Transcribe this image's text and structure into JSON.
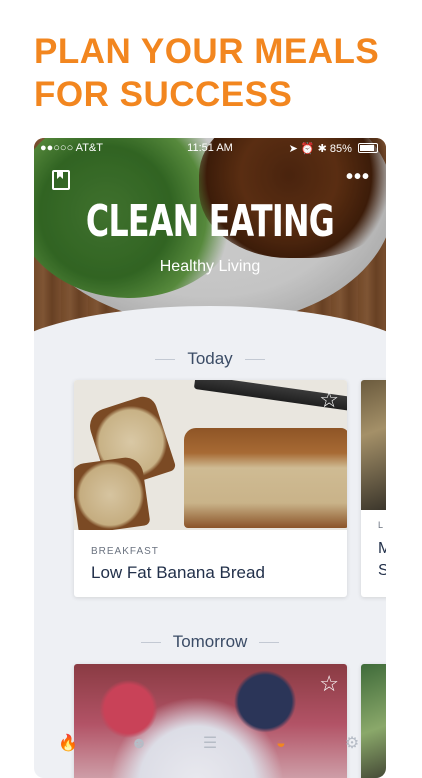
{
  "headline": {
    "line1": "PLAN YOUR MEALS",
    "line2": "FOR SUCCESS"
  },
  "status_bar": {
    "carrier": "●●○○○ AT&T",
    "time": "11:51 AM",
    "battery": "85%",
    "battery_level": 0.85,
    "icons": [
      "wifi-icon",
      "location-arrow-icon",
      "alarm-icon",
      "bluetooth-icon",
      "battery-icon"
    ]
  },
  "hero": {
    "title": "CLEAN EATING",
    "subtitle": "Healthy Living",
    "bookmark_icon": "bookmark-icon",
    "more_icon": "more-dots-icon",
    "more_glyph": "•••"
  },
  "sections": [
    {
      "label": "Today"
    },
    {
      "label": "Tomorrow"
    }
  ],
  "cards": [
    {
      "category": "BREAKFAST",
      "title": "Low Fat Banana Bread",
      "favorite": false
    },
    {
      "category": "",
      "title": "",
      "favorite": false
    }
  ],
  "peek_card": {
    "category": "L",
    "title_line1": "M",
    "title_line2": "S"
  },
  "star_glyph": "☆",
  "tab_bar": {
    "tabs": [
      {
        "icon": "flame-icon",
        "glyph": "🔥",
        "active": false
      },
      {
        "icon": "smiley-icon",
        "glyph": "☻",
        "active": false
      },
      {
        "icon": "recipe-icon",
        "glyph": "☰",
        "active": false
      },
      {
        "icon": "meal-bowl-icon",
        "glyph": "◒",
        "active": true
      },
      {
        "icon": "settings-gear-icon",
        "glyph": "⚙",
        "active": false
      }
    ]
  },
  "colors": {
    "accent": "#f2861f",
    "navy": "#22304a",
    "background": "#eef0f4"
  }
}
